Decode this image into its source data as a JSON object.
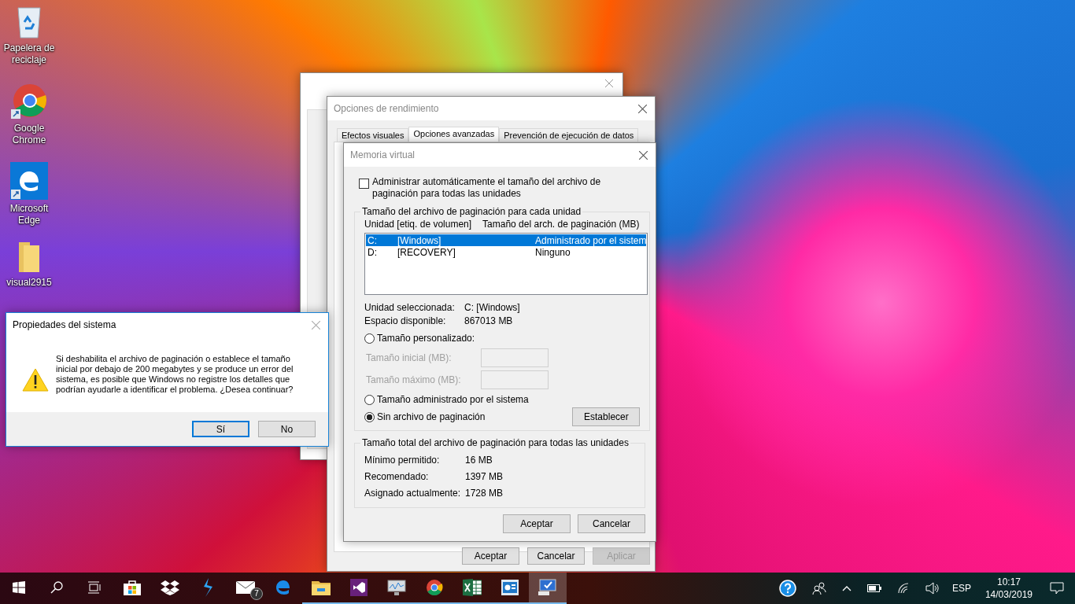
{
  "desktop_icons": [
    {
      "kind": "recycle",
      "label": "Papelera de reciclaje"
    },
    {
      "kind": "chrome",
      "label": "Google Chrome"
    },
    {
      "kind": "edge",
      "label": "Microsoft Edge"
    },
    {
      "kind": "folder",
      "label": "visual2915"
    }
  ],
  "performance_options": {
    "title": "Opciones de rendimiento",
    "tabs": [
      {
        "label": "Efectos visuales",
        "selected": false
      },
      {
        "label": "Opciones avanzadas",
        "selected": true
      },
      {
        "label": "Prevención de ejecución de datos",
        "selected": false
      }
    ],
    "buttons": [
      {
        "label": "Aceptar",
        "disabled": false
      },
      {
        "label": "Cancelar",
        "disabled": false
      },
      {
        "label": "Aplicar",
        "disabled": true
      }
    ]
  },
  "virtual_memory": {
    "title": "Memoria virtual",
    "auto_manage": {
      "label": "Administrar automáticamente el tamaño del archivo de paginación para todas las unidades",
      "checked": false
    },
    "drives_group": {
      "title": "Tamaño del archivo de paginación para cada unidad",
      "columns": [
        "Unidad [etiq. de volumen]",
        "Tamaño del arch. de paginación (MB)"
      ],
      "drives": [
        {
          "drive": "C:",
          "label": "[Windows]",
          "size": "Administrado por el sistem",
          "selected": true
        },
        {
          "drive": "D:",
          "label": "[RECOVERY]",
          "size": "Ninguno",
          "selected": false
        }
      ],
      "info": [
        {
          "label": "Unidad seleccionada:",
          "value": "C:  [Windows]"
        },
        {
          "label": "Espacio disponible:",
          "value": "867013 MB"
        }
      ],
      "size_options": [
        {
          "kind": "custom",
          "label": "Tamaño personalizado:",
          "selected": false
        },
        {
          "kind": "system",
          "label": "Tamaño administrado por el sistema",
          "selected": false
        },
        {
          "kind": "none",
          "label": "Sin archivo de paginación",
          "selected": true
        }
      ],
      "custom_fields": [
        {
          "label": "Tamaño inicial (MB):",
          "disabled": true
        },
        {
          "label": "Tamaño máximo (MB):",
          "disabled": true
        }
      ],
      "set_button": "Establecer"
    },
    "totals_group": {
      "title": "Tamaño total del archivo de paginación para todas las unidades",
      "rows": [
        {
          "label": "Mínimo permitido:",
          "value": "16 MB"
        },
        {
          "label": "Recomendado:",
          "value": "1397 MB"
        },
        {
          "label": "Asignado actualmente:",
          "value": "1728 MB"
        }
      ]
    },
    "buttons": [
      "Aceptar",
      "Cancelar"
    ]
  },
  "message_box": {
    "title": "Propiedades del sistema",
    "message": "Si deshabilita el archivo de paginación o establece el tamaño inicial por debajo de 200 megabytes y se produce un error del sistema, es posible que Windows no registre los detalles que podrían ayudarle a identificar el problema. ¿Desea continuar?",
    "buttons": [
      {
        "label": "Sí",
        "selected": true
      },
      {
        "label": "No",
        "selected": false
      }
    ]
  },
  "taskbar": {
    "apps": [
      {
        "kind": "start",
        "running": false,
        "selected": false
      },
      {
        "kind": "search",
        "running": false,
        "selected": false
      },
      {
        "kind": "taskview",
        "running": false,
        "selected": false
      },
      {
        "kind": "store",
        "running": false,
        "selected": false
      },
      {
        "kind": "dropbox",
        "running": false,
        "selected": false
      },
      {
        "kind": "bolt",
        "running": false,
        "selected": false
      },
      {
        "kind": "mail",
        "running": false,
        "selected": false,
        "badge": "7"
      },
      {
        "kind": "edge",
        "running": false,
        "selected": false
      },
      {
        "kind": "explorer",
        "running": true,
        "selected": false
      },
      {
        "kind": "vs",
        "running": true,
        "selected": false
      },
      {
        "kind": "monitor",
        "running": true,
        "selected": false
      },
      {
        "kind": "chrome",
        "running": true,
        "selected": false
      },
      {
        "kind": "excel",
        "running": true,
        "selected": false
      },
      {
        "kind": "slides",
        "running": true,
        "selected": false
      },
      {
        "kind": "computer",
        "running": true,
        "selected": true
      }
    ],
    "language": "ESP",
    "time": "10:17",
    "date": "14/03/2019"
  }
}
